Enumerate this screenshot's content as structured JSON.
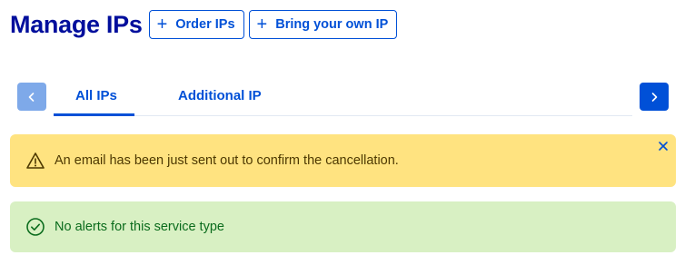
{
  "header": {
    "title": "Manage IPs",
    "buttons": [
      {
        "label": "Order IPs",
        "icon": "plus-icon"
      },
      {
        "label": "Bring your own IP",
        "icon": "plus-icon"
      }
    ]
  },
  "tabs": {
    "items": [
      {
        "label": "All IPs",
        "active": true
      },
      {
        "label": "Additional IP",
        "active": false
      }
    ],
    "prev_icon": "chevron-left-icon",
    "next_icon": "chevron-right-icon"
  },
  "alerts": {
    "warning": {
      "message": "An email has been just sent out to confirm the cancellation.",
      "icon": "warning-triangle-icon",
      "close_icon": "close-icon"
    },
    "success": {
      "message": "No alerts for this service type",
      "icon": "check-circle-icon"
    }
  },
  "colors": {
    "primary": "#0050d7",
    "title": "#000e9c",
    "warning_bg": "#ffe380",
    "success_bg": "#d8f0c3",
    "success_text": "#0b6c1d"
  }
}
